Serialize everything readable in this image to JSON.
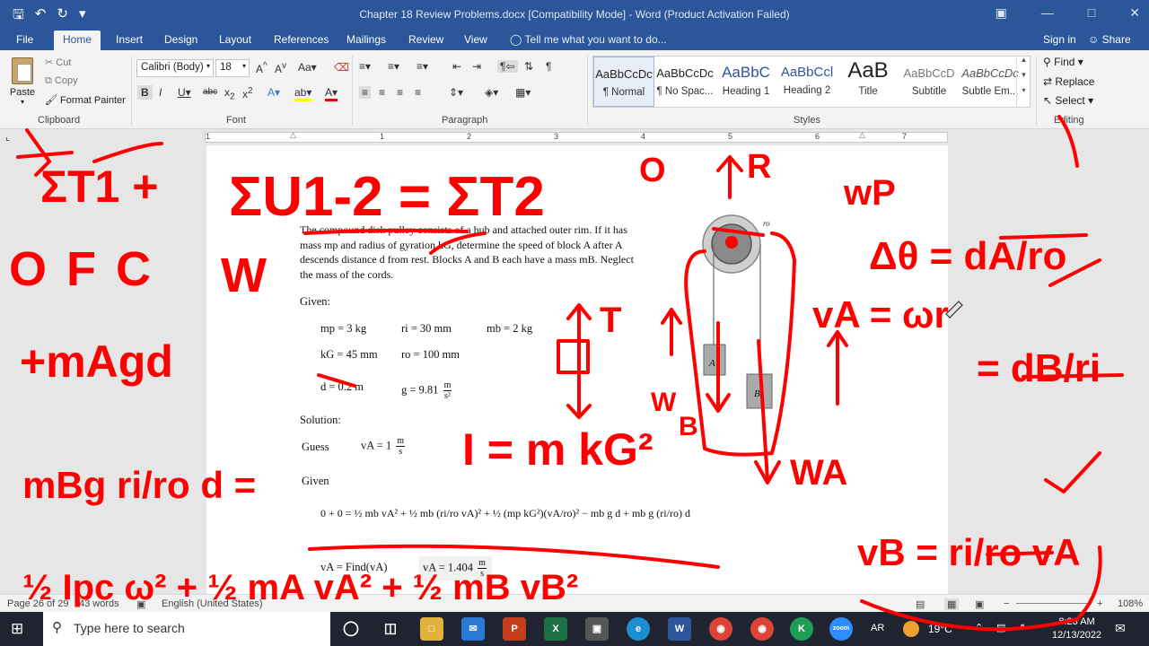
{
  "window": {
    "title": "Chapter 18 Review Problems.docx [Compatibility Mode] - Word (Product Activation Failed)",
    "quick_access": [
      "save-icon",
      "undo-icon",
      "redo-icon",
      "customize-icon"
    ],
    "controls": [
      "ribbon-display-icon",
      "minimize-icon",
      "maximize-icon",
      "close-icon"
    ]
  },
  "tabs": [
    "File",
    "Home",
    "Insert",
    "Design",
    "Layout",
    "References",
    "Mailings",
    "Review",
    "View"
  ],
  "active_tab": "Home",
  "tell_me": "Tell me what you want to do...",
  "sign_in": "Sign in",
  "share": "Share",
  "clipboard": {
    "paste": "Paste",
    "cut": "Cut",
    "copy": "Copy",
    "format_painter": "Format Painter",
    "label": "Clipboard"
  },
  "font": {
    "name": "Calibri (Body)",
    "size": "18",
    "label": "Font"
  },
  "paragraph": {
    "label": "Paragraph"
  },
  "styles": {
    "label": "Styles",
    "items": [
      {
        "sample": "AaBbCcDc",
        "name": "¶ Normal"
      },
      {
        "sample": "AaBbCcDc",
        "name": "¶ No Spac..."
      },
      {
        "sample": "AaBbC",
        "name": "Heading 1"
      },
      {
        "sample": "AaBbCcl",
        "name": "Heading 2"
      },
      {
        "sample": "AaB",
        "name": "Title"
      },
      {
        "sample": "AaBbCcD",
        "name": "Subtitle"
      },
      {
        "sample": "AaBbCcDc",
        "name": "Subtle Em..."
      }
    ]
  },
  "editing": {
    "find": "Find",
    "replace": "Replace",
    "select": "Select",
    "label": "Editing"
  },
  "ruler_numbers": [
    "1",
    "1",
    "2",
    "3",
    "4",
    "5",
    "6",
    "7"
  ],
  "document": {
    "problem": "The compound disk pulley consists of a hub and attached outer rim. If it has mass mp and radius of gyration kG, determine the speed of block A after A descends distance d from rest. Blocks A and B each have a mass mB. Neglect the mass of the cords.",
    "given_label": "Given:",
    "mp": "mp = 3 kg",
    "ri": "ri = 30 mm",
    "mb": "mb = 2 kg",
    "kg": "kG = 45 mm",
    "ro": "ro = 100 mm",
    "d": "d = 0.2 m",
    "g": "g = 9.81",
    "g_unit_num": "m",
    "g_unit_den": "s²",
    "solution_label": "Solution:",
    "guess_label": "Guess",
    "guess": "vA = 1",
    "guess_unit_num": "m",
    "guess_unit_den": "s",
    "given2_label": "Given",
    "equation": "0 + 0 = ½ mb vA² + ½ mb (ri/ro vA)² + ½ (mp kG²)(vA/ro)² − mb g d + mb g (ri/ro) d",
    "find": "vA = Find(vA)",
    "result": "vA = 1.404",
    "result_unit_num": "m",
    "result_unit_den": "s",
    "diagram_labels": {
      "rim": "ro",
      "block_a": "A",
      "block_b": "B"
    }
  },
  "status": {
    "page": "Page 26 of 29",
    "words": "43 words",
    "language": "English (United States)",
    "zoom": "108%"
  },
  "taskbar": {
    "search": "Type here to search",
    "weather": "19°C",
    "lang": "AR",
    "time": "8:23 AM",
    "date": "12/13/2022"
  },
  "ink": {
    "color": "#ff0000",
    "labels": [
      "ΣT1 +",
      "OFC",
      "+mAgd",
      "mBg ri/ro d =",
      "½ Ipc ω² + ½ mA vA² + ½ mB vB²",
      "ΣU1-2 = ΣT2",
      "W",
      "T",
      "W",
      "B",
      "I = m kG²",
      "WA",
      "O",
      "R",
      "wP",
      "Δθ = dA/ro",
      "vA = ωr",
      "= dB/ri",
      "vB = ri/ro vA"
    ]
  }
}
